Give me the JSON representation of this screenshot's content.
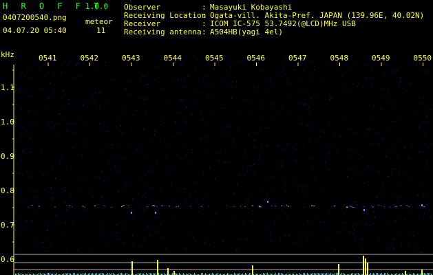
{
  "app": {
    "name": "H R O F F T",
    "version": "1.0.0"
  },
  "file": {
    "filename": "0407200540.png",
    "datetime": "04.07.20 05:40"
  },
  "meteor": {
    "label": "meteor",
    "count": "11"
  },
  "info": [
    {
      "key": "Observer",
      "sep": ":",
      "value": "Masayuki Kobayashi"
    },
    {
      "key": "Receiving Location",
      "sep": ":",
      "value": "Ogata-vill. Akita-Pref. JAPAN (139.96E, 40.02N)"
    },
    {
      "key": "Receiver",
      "sep": ":",
      "value": "ICOM IC-575 53.7492(@LCD)MHz USB"
    },
    {
      "key": "Receiving antenna",
      "sep": ":",
      "value": "A504HB(yagi 4el)"
    }
  ],
  "spectrogram": {
    "unit": "kHz",
    "time_ticks": [
      "0541",
      "0542",
      "0543",
      "0544",
      "0545",
      "0546",
      "0547",
      "0548",
      "0549",
      "0550"
    ],
    "freq_ticks": [
      {
        "label": "1.1",
        "value": 1.1
      },
      {
        "label": "1.0",
        "value": 1.0
      },
      {
        "label": "0.9",
        "value": 0.9
      },
      {
        "label": "0.8",
        "value": 0.8
      },
      {
        "label": "0.7",
        "value": 0.7
      },
      {
        "label": "0.6",
        "value": 0.6
      }
    ],
    "colors": {
      "background": "#000000",
      "noise": "#1a1a8c",
      "echo": "#ffffff",
      "text": "#ffff40",
      "level_meter": "#ffff40",
      "level_base": "#30e0e0"
    }
  }
}
